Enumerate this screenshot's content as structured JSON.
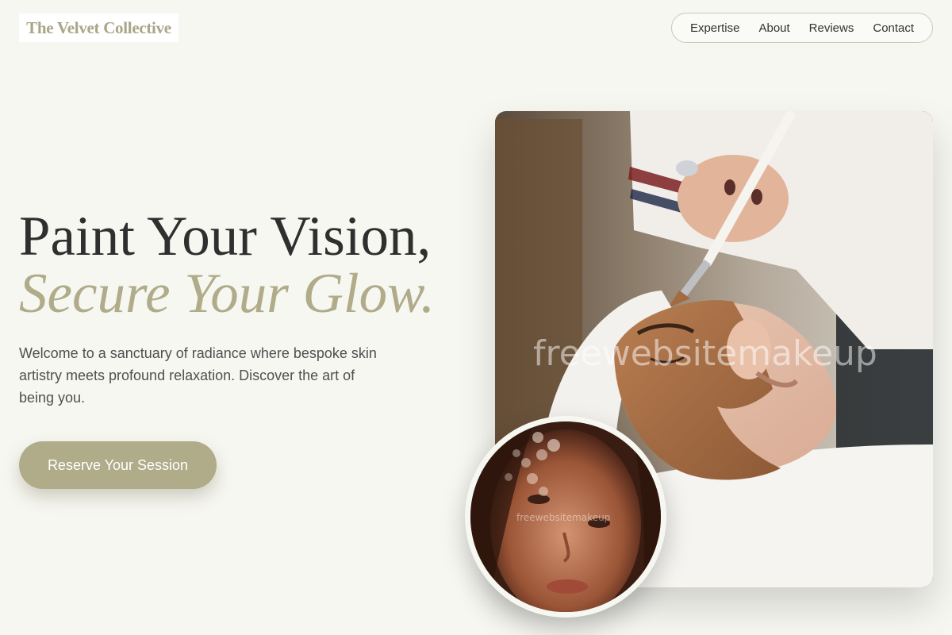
{
  "brand": {
    "name": "The Velvet Collective"
  },
  "nav": {
    "items": [
      {
        "label": "Expertise"
      },
      {
        "label": "About"
      },
      {
        "label": "Reviews"
      },
      {
        "label": "Contact"
      }
    ]
  },
  "hero": {
    "headline_line1": "Paint Your Vision,",
    "headline_line2": "Secure Your Glow.",
    "intro": "Welcome to a sanctuary of radiance where bespoke skin artistry meets profound relaxation. Discover the art of being you.",
    "cta_label": "Reserve Your Session"
  },
  "images": {
    "main_alt": "Esthetician applying a clay facial mask with a brush to a client wearing a white headband",
    "inset_alt": "Close-up portrait of a woman with glowing skin and bokeh highlights",
    "watermark": "freewebsitemakeup",
    "watermark_small": "freewebsitemakeup"
  },
  "colors": {
    "background": "#f7f7f2",
    "accent": "#b0ab89",
    "headline": "#2f2f2f",
    "body_text": "#4f4f4f",
    "nav_border": "#c9c8b6"
  }
}
